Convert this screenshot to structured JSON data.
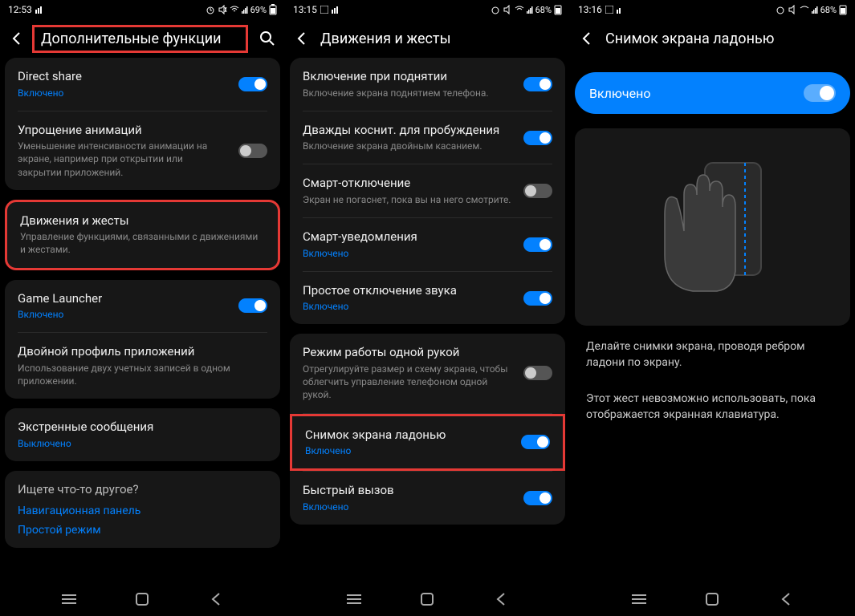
{
  "screen1": {
    "status": {
      "time": "12:53",
      "battery": "69%"
    },
    "title": "Дополнительные функции",
    "items": {
      "direct_share": {
        "title": "Direct share",
        "sub": "Включено"
      },
      "anim": {
        "title": "Упрощение анимаций",
        "sub": "Уменьшение интенсивности анимации на экране, например при открытии или закрытии приложений."
      },
      "motion": {
        "title": "Движения и жесты",
        "sub": "Управление функциями, связанными с движениями и жестами."
      },
      "game": {
        "title": "Game Launcher",
        "sub": "Включено"
      },
      "dual": {
        "title": "Двойной профиль приложений",
        "sub": "Использование двух учетных записей в одном приложении."
      },
      "sos": {
        "title": "Экстренные сообщения",
        "sub": "Выключено"
      }
    },
    "suggest": {
      "title": "Ищете что-то другое?",
      "link1": "Навигационная панель",
      "link2": "Простой режим"
    }
  },
  "screen2": {
    "status": {
      "time": "13:15",
      "battery": "68%"
    },
    "title": "Движения и жесты",
    "items": {
      "lift": {
        "title": "Включение при поднятии",
        "sub": "Включение экрана поднятием телефона."
      },
      "dtap": {
        "title": "Дважды коснит. для пробуждения",
        "sub": "Включение экрана двойным касанием."
      },
      "smart_off": {
        "title": "Смарт-отключение",
        "sub": "Экран не погаснет, пока вы на него смотрите."
      },
      "smart_notif": {
        "title": "Смарт-уведомления",
        "sub": "Включено"
      },
      "mute": {
        "title": "Простое отключение звука",
        "sub": "Включено"
      },
      "onehand": {
        "title": "Режим работы одной рукой",
        "sub": "Отрегулируйте размер и схему экрана, чтобы облегчить управление телефоном одной рукой."
      },
      "palm": {
        "title": "Снимок экрана ладонью",
        "sub": "Включено"
      },
      "call": {
        "title": "Быстрый вызов",
        "sub": "Включено"
      }
    }
  },
  "screen3": {
    "status": {
      "time": "13:16",
      "battery": "68%"
    },
    "title": "Снимок экрана ладонью",
    "enabled": "Включено",
    "desc1": "Делайте снимки экрана, проводя ребром ладони по экрану.",
    "desc2": "Этот жест невозможно использовать, пока отображается экранная клавиатура."
  }
}
